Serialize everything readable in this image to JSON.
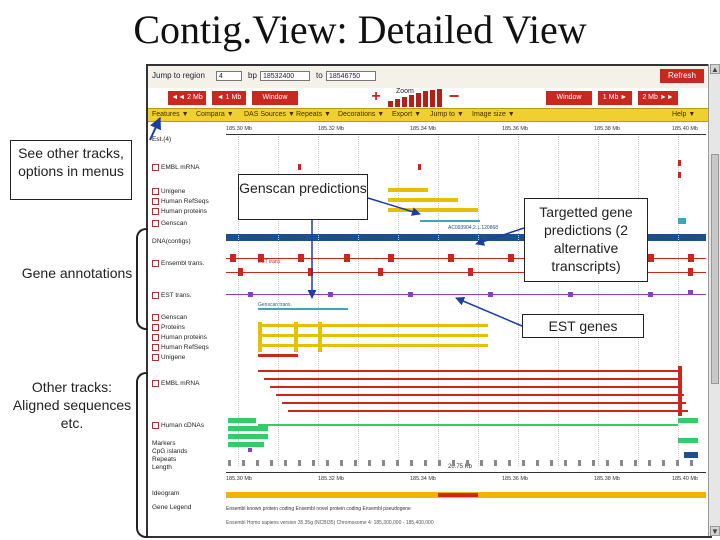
{
  "slide": {
    "title": "Contig.View: Detailed View"
  },
  "jump": {
    "label": "Jump to region",
    "chromosome": "4",
    "bp_label": "bp",
    "start": "18532400",
    "to_label": "to",
    "end": "18546750",
    "refresh_label": "Refresh"
  },
  "nav": {
    "back2": "◄◄ 2 Mb",
    "back1": "◄ 1 Mb",
    "window_left": "Window",
    "zoom_label": "Zoom",
    "window_right": "Window",
    "fwd1": "1 Mb ►",
    "fwd2": "2 Mb ►►"
  },
  "menus": [
    "Features ▼",
    "Compara ▼",
    "DAS Sources ▼",
    "Repeats ▼",
    "Decorations ▼",
    "Export ▼",
    "Jump to ▼",
    "Image size ▼",
    "Help ▼"
  ],
  "tracks": [
    "Est.(4)",
    "EMBL mRNA",
    "Unigene",
    "Human RefSeqs",
    "Human proteins",
    "Genscan",
    "DNA(contigs)",
    "Ensembl trans.",
    "EST trans.",
    "Genscan",
    "Proteins",
    "Human proteins",
    "Human RefSeqs",
    "Unigene",
    "EMBL mRNA",
    "Human cDNAs",
    "Markers",
    "CpG islands",
    "Repeats",
    "Length",
    "Ideogram",
    "Gene Legend"
  ],
  "scale_ticks": [
    "185.30 Mb",
    "185.32 Mb",
    "185.34 Mb",
    "185.36 Mb",
    "185.38 Mb",
    "185.40 Mb"
  ],
  "length_label": "20.75 Kb",
  "feature_labels": {
    "contig": "AC093904.2.1.120868",
    "est_label": "EST trans.",
    "genscan_label": "Genscan trans."
  },
  "legend_text": "Ensembl known protein coding   Ensembl novel protein coding   Ensembl pseudogene",
  "footer_text": "Ensembl Homo sapiens version 35.35g (NCBI35) Chromosome 4: 185,300,000 - 185,400,000",
  "callouts": {
    "tracks_options": "See other tracks, options in menus",
    "gene_annotations": "Gene annotations",
    "other_tracks": "Other tracks: Aligned sequences etc.",
    "genscan": "Genscan predictions",
    "targetted": "Targetted gene predictions (2 alternative transcripts)",
    "est_genes": "EST genes"
  },
  "colors": {
    "nav_red": "#c8281e",
    "menu_yellow": "#f0d030",
    "contig_blue": "#1f4f8a",
    "gene_red": "#c8281e",
    "est_purple": "#8a3fbf",
    "protein_yellow": "#e6c000",
    "cdna_green": "#33cc66",
    "genscan_teal": "#3aa8b8"
  }
}
